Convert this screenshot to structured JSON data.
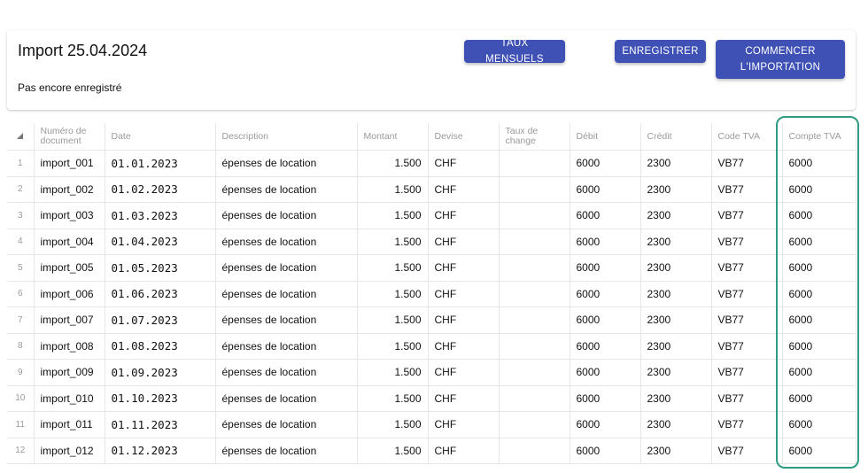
{
  "header": {
    "title": "Import 25.04.2024",
    "status": "Pas encore enregistré",
    "buttons": {
      "monthly_rates": "Taux mensuels",
      "save": "Enregistrer",
      "start_import": "Commencer l'importation"
    }
  },
  "grid": {
    "columns": [
      "Numéro de document",
      "Date",
      "Description",
      "Montant",
      "Devise",
      "Taux de change",
      "Débit",
      "Crédit",
      "Code TVA",
      "Compte TVA"
    ],
    "rows": [
      {
        "n": "1",
        "doc": "import_001",
        "date": "01.01.2023",
        "desc": "épenses de location",
        "amount": "1.500",
        "currency": "CHF",
        "rate": "",
        "debit": "6000",
        "credit": "2300",
        "vat_code": "VB77",
        "vat_account": "6000"
      },
      {
        "n": "2",
        "doc": "import_002",
        "date": "01.02.2023",
        "desc": "épenses de location",
        "amount": "1.500",
        "currency": "CHF",
        "rate": "",
        "debit": "6000",
        "credit": "2300",
        "vat_code": "VB77",
        "vat_account": "6000"
      },
      {
        "n": "3",
        "doc": "import_003",
        "date": "01.03.2023",
        "desc": "épenses de location",
        "amount": "1.500",
        "currency": "CHF",
        "rate": "",
        "debit": "6000",
        "credit": "2300",
        "vat_code": "VB77",
        "vat_account": "6000"
      },
      {
        "n": "4",
        "doc": "import_004",
        "date": "01.04.2023",
        "desc": "épenses de location",
        "amount": "1.500",
        "currency": "CHF",
        "rate": "",
        "debit": "6000",
        "credit": "2300",
        "vat_code": "VB77",
        "vat_account": "6000"
      },
      {
        "n": "5",
        "doc": "import_005",
        "date": "01.05.2023",
        "desc": "épenses de location",
        "amount": "1.500",
        "currency": "CHF",
        "rate": "",
        "debit": "6000",
        "credit": "2300",
        "vat_code": "VB77",
        "vat_account": "6000"
      },
      {
        "n": "6",
        "doc": "import_006",
        "date": "01.06.2023",
        "desc": "épenses de location",
        "amount": "1.500",
        "currency": "CHF",
        "rate": "",
        "debit": "6000",
        "credit": "2300",
        "vat_code": "VB77",
        "vat_account": "6000"
      },
      {
        "n": "7",
        "doc": "import_007",
        "date": "01.07.2023",
        "desc": "épenses de location",
        "amount": "1.500",
        "currency": "CHF",
        "rate": "",
        "debit": "6000",
        "credit": "2300",
        "vat_code": "VB77",
        "vat_account": "6000"
      },
      {
        "n": "8",
        "doc": "import_008",
        "date": "01.08.2023",
        "desc": "épenses de location",
        "amount": "1.500",
        "currency": "CHF",
        "rate": "",
        "debit": "6000",
        "credit": "2300",
        "vat_code": "VB77",
        "vat_account": "6000"
      },
      {
        "n": "9",
        "doc": "import_009",
        "date": "01.09.2023",
        "desc": "épenses de location",
        "amount": "1.500",
        "currency": "CHF",
        "rate": "",
        "debit": "6000",
        "credit": "2300",
        "vat_code": "VB77",
        "vat_account": "6000"
      },
      {
        "n": "10",
        "doc": "import_010",
        "date": "01.10.2023",
        "desc": "épenses de location",
        "amount": "1.500",
        "currency": "CHF",
        "rate": "",
        "debit": "6000",
        "credit": "2300",
        "vat_code": "VB77",
        "vat_account": "6000"
      },
      {
        "n": "11",
        "doc": "import_011",
        "date": "01.11.2023",
        "desc": "épenses de location",
        "amount": "1.500",
        "currency": "CHF",
        "rate": "",
        "debit": "6000",
        "credit": "2300",
        "vat_code": "VB77",
        "vat_account": "6000"
      },
      {
        "n": "12",
        "doc": "import_012",
        "date": "01.12.2023",
        "desc": "épenses de location",
        "amount": "1.500",
        "currency": "CHF",
        "rate": "",
        "debit": "6000",
        "credit": "2300",
        "vat_code": "VB77",
        "vat_account": "6000"
      }
    ]
  },
  "colors": {
    "primary": "#3f51b5",
    "highlight": "#2e9b83",
    "header_text": "#9a9a9a"
  },
  "icons": {
    "corner": "sort-corner-icon"
  }
}
